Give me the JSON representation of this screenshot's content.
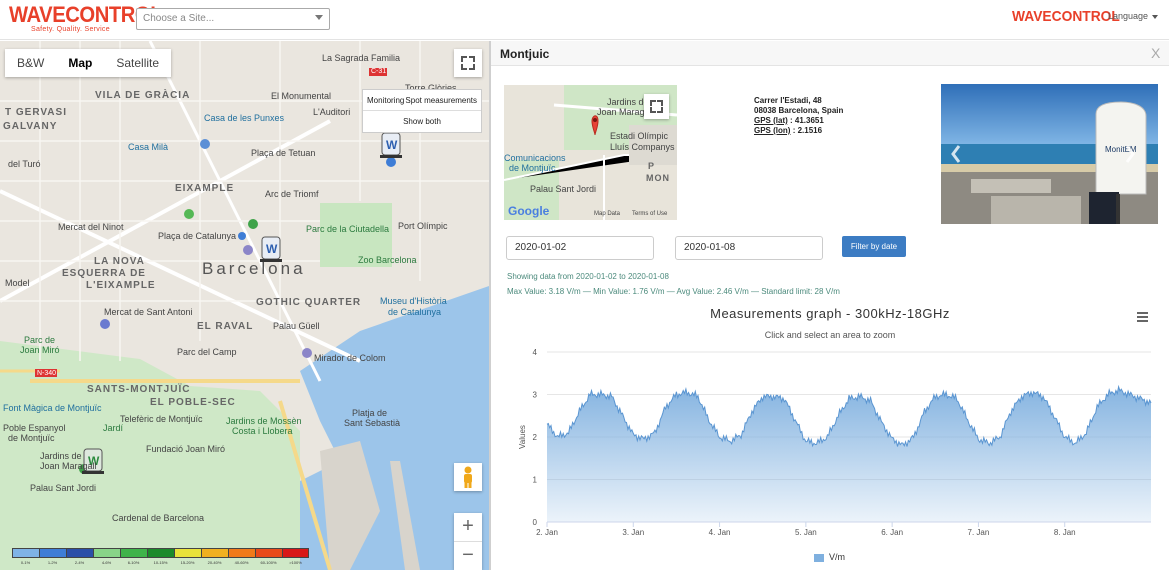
{
  "header": {
    "logo": "WAVECONTROL",
    "tagline": "Safety. Quality. Service",
    "site_select_placeholder": "Choose a Site...",
    "logo_right": "WAVECONTROL",
    "language": "Language"
  },
  "map": {
    "type_buttons": [
      "B&W",
      "Map",
      "Satellite"
    ],
    "active_type": "Map",
    "layer_toggle": {
      "monitoring": "Monitoring",
      "spot": "Spot measurements",
      "both": "Show both"
    },
    "labels": {
      "sagrada": "La Sagrada Familia",
      "torre": "Torre Glòries",
      "vila": "VILA DE GRÀCIA",
      "gervasi": "T GERVASI",
      "galvany": "GALVANY",
      "monumental": "El Monumental",
      "auditori": "L'Auditori",
      "punxes": "Casa de les Punxes",
      "mila": "Casa Milà",
      "tetuan": "Plaça de Tetuan",
      "turo": "del Turó",
      "eixample": "EIXAMPLE",
      "arc": "Arc de Triomf",
      "ninot": "Mercat del Ninot",
      "catalunya": "Plaça de Catalunya",
      "parc": "Parc de la Ciutadella",
      "olimpic": "Port Olímpic",
      "barcelona": "Barcelona",
      "nova": "LA NOVA",
      "esquerra": "ESQUERRA DE",
      "lexample": "L'EIXAMPLE",
      "model": "Model",
      "zoo": "Zoo Barcelona",
      "gothic": "GOTHIC QUARTER",
      "museu": "Museu d'Història",
      "catalunya2": "de Catalunya",
      "antoni": "Mercat de Sant Antoni",
      "raval": "EL RAVAL",
      "guell": "Palau Güell",
      "parcde": "Parc de",
      "joanmiro": "Joan Miró",
      "calltop": "Parc del Camp",
      "colom": "Mirador de Colom",
      "santsm": "SANTS-MONTJUÏC",
      "poblesec": "EL POBLE-SEC",
      "magica": "Font Màgica de Montjuïc",
      "teleferic": "Telefèric de Montjuïc",
      "jardinsm": "Jardins de Mossèn",
      "costa": "Costa i Llobera",
      "poble": "Poble Espanyol",
      "montjuic": "de Montjuïc",
      "fundacio": "Fundació Joan Miró",
      "platja": "Platja de",
      "sebastia": "Sant Sebastià",
      "jardinsj": "Jardins de",
      "joanm": "Joan Maragall",
      "palausj": "Palau Sant Jordi",
      "cardenal": "Cardenal de Barcelona",
      "jardi": "Jardí",
      "rd": "C-31",
      "n340": "N-340"
    },
    "legend_labels": [
      "0-1%",
      "1-2%",
      "2-4%",
      "4-6%",
      "6-10%",
      "10-15%",
      "15-20%",
      "20-40%",
      "40-60%",
      "60-100%",
      ">100%"
    ],
    "legend_colors": [
      "#7fb3e6",
      "#3e7dd6",
      "#2b4fa8",
      "#88d488",
      "#3fb34a",
      "#1b8a2a",
      "#e8e23a",
      "#f0b020",
      "#f07a1a",
      "#e84a1a",
      "#d81818"
    ]
  },
  "panel": {
    "title": "Montjuic",
    "close": "X",
    "minimap": {
      "jardins": "Jardins de",
      "maragall": "Joan Maragall",
      "estadi": "Estadi Olímpic",
      "lluis": "Lluís Companys",
      "comunicacions": "Comunicacions",
      "demontjuic": "de Montjuïc",
      "palau": "Palau Sant Jordi",
      "pmon": "P",
      "mon": "MON",
      "google": "Google",
      "mapdata": "Map Data",
      "terms": "Terms of Use"
    },
    "address": {
      "street": "Carrer l'Estadi, 48",
      "city": "08038 Barcelona, Spain",
      "lat_label": "GPS (lat)",
      "lat": ": 41.3651",
      "lon_label": "GPS (lon)",
      "lon": ": 2.1516"
    },
    "photo_brand": "MonitEM",
    "date_from": "2020-01-02",
    "date_to": "2020-01-08",
    "filter_button": "Filter by date",
    "showing": "Showing data from 2020-01-02 to 2020-01-08",
    "stats": "Max Value: 3.18 V/m — Min Value: 1.76 V/m — Avg Value: 2.46 V/m — Standard limit: 28 V/m"
  },
  "chart_data": {
    "type": "area",
    "title": "Measurements graph - 300kHz-18GHz",
    "subtitle": "Click and select an area to zoom",
    "ylabel": "Values",
    "ylim": [
      0,
      4
    ],
    "yticks": [
      "0",
      "1",
      "2",
      "3",
      "4"
    ],
    "xticks": [
      "2. Jan",
      "3. Jan",
      "4. Jan",
      "5. Jan",
      "6. Jan",
      "7. Jan",
      "8. Jan"
    ],
    "series": [
      {
        "name": "V/m",
        "color": "#7fb0df",
        "x": [
          "2020-01-02 00:00",
          "2020-01-02 03:00",
          "2020-01-02 06:00",
          "2020-01-02 09:00",
          "2020-01-02 12:00",
          "2020-01-02 15:00",
          "2020-01-02 18:00",
          "2020-01-02 21:00",
          "2020-01-03 00:00",
          "2020-01-03 03:00",
          "2020-01-03 06:00",
          "2020-01-03 09:00",
          "2020-01-03 12:00",
          "2020-01-03 15:00",
          "2020-01-03 18:00",
          "2020-01-03 21:00",
          "2020-01-04 00:00",
          "2020-01-04 03:00",
          "2020-01-04 06:00",
          "2020-01-04 09:00",
          "2020-01-04 12:00",
          "2020-01-04 15:00",
          "2020-01-04 18:00",
          "2020-01-04 21:00",
          "2020-01-05 00:00",
          "2020-01-05 03:00",
          "2020-01-05 06:00",
          "2020-01-05 09:00",
          "2020-01-05 12:00",
          "2020-01-05 15:00",
          "2020-01-05 18:00",
          "2020-01-05 21:00",
          "2020-01-06 00:00",
          "2020-01-06 03:00",
          "2020-01-06 06:00",
          "2020-01-06 09:00",
          "2020-01-06 12:00",
          "2020-01-06 15:00",
          "2020-01-06 18:00",
          "2020-01-06 21:00",
          "2020-01-07 00:00",
          "2020-01-07 03:00",
          "2020-01-07 06:00",
          "2020-01-07 09:00",
          "2020-01-07 12:00",
          "2020-01-07 15:00",
          "2020-01-07 18:00",
          "2020-01-07 21:00",
          "2020-01-08 00:00",
          "2020-01-08 03:00",
          "2020-01-08 06:00",
          "2020-01-08 09:00",
          "2020-01-08 12:00",
          "2020-01-08 15:00",
          "2020-01-08 18:00",
          "2020-01-08 21:00",
          "2020-01-09 00:00"
        ],
        "values": [
          2.3,
          2.0,
          2.1,
          2.6,
          3.0,
          3.0,
          2.95,
          2.5,
          2.05,
          1.95,
          2.1,
          2.7,
          3.0,
          3.05,
          2.95,
          2.4,
          2.0,
          1.9,
          2.05,
          2.6,
          2.95,
          2.95,
          2.9,
          2.4,
          1.9,
          1.85,
          2.0,
          2.5,
          2.9,
          2.95,
          2.85,
          2.35,
          1.95,
          1.8,
          2.0,
          2.6,
          2.95,
          3.0,
          2.9,
          2.4,
          1.95,
          1.85,
          2.0,
          2.6,
          2.95,
          3.05,
          2.95,
          2.5,
          2.0,
          1.85,
          2.1,
          2.7,
          3.0,
          3.1,
          3.0,
          2.9,
          2.8
        ]
      }
    ]
  }
}
